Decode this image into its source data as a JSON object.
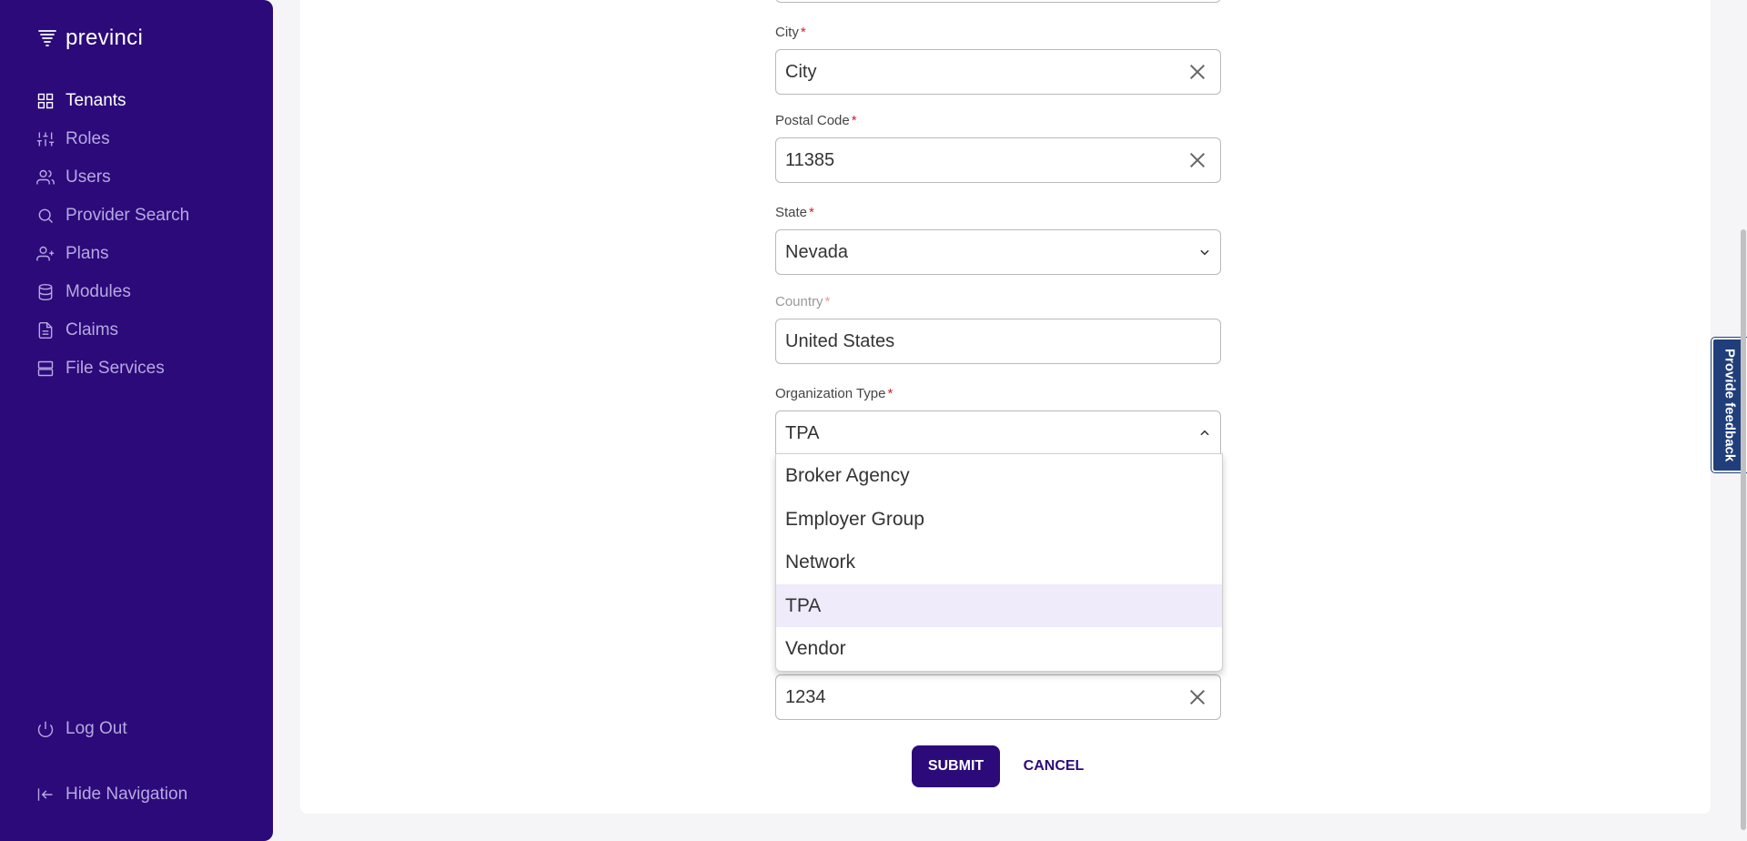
{
  "app": {
    "logo_text": "previnci"
  },
  "sidebar": {
    "items": [
      {
        "label": "Tenants",
        "icon": "grid-icon"
      },
      {
        "label": "Roles",
        "icon": "sliders-icon"
      },
      {
        "label": "Users",
        "icon": "users-icon"
      },
      {
        "label": "Provider Search",
        "icon": "search-icon"
      },
      {
        "label": "Plans",
        "icon": "user-plus-icon"
      },
      {
        "label": "Modules",
        "icon": "database-icon"
      },
      {
        "label": "Claims",
        "icon": "file-icon"
      },
      {
        "label": "File Services",
        "icon": "server-icon"
      }
    ],
    "logout_label": "Log Out",
    "hide_nav_label": "Hide Navigation"
  },
  "form": {
    "city": {
      "label": "City",
      "value": "City"
    },
    "postal_code": {
      "label": "Postal Code",
      "value": "11385"
    },
    "state": {
      "label": "State",
      "value": "Nevada"
    },
    "country": {
      "label": "Country",
      "value": "United States"
    },
    "organization_type": {
      "label": "Organization Type",
      "value": "TPA",
      "options": [
        "Broker Agency",
        "Employer Group",
        "Network",
        "TPA",
        "Vendor"
      ]
    },
    "hidden_field": {
      "value": "1234"
    },
    "required_marker": "*",
    "submit_label": "SUBMIT",
    "cancel_label": "CANCEL"
  },
  "feedback": {
    "label": "Provide feedback"
  },
  "colors": {
    "sidebar": "#2c0a7a",
    "accent": "#2c0a7a",
    "required": "#d0202e",
    "selected_option": "#efebfb",
    "feedback": "#1f3e7a"
  }
}
